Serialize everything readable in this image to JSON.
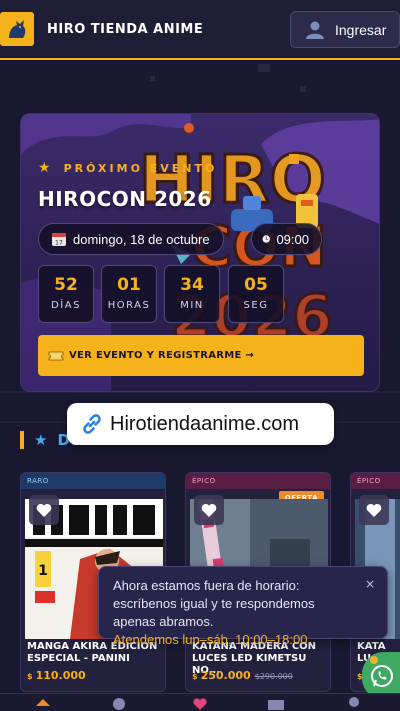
{
  "header": {
    "brand": "HIRO TIENDA ANIME",
    "login_label": "Ingresar"
  },
  "event": {
    "eyebrow": "PRÓXIMO EVENTO",
    "title": "HIROCON 2026",
    "date": "domingo, 18 de octubre",
    "time": "09:00",
    "countdown": [
      {
        "value": "52",
        "unit": "DÍAS"
      },
      {
        "value": "01",
        "unit": "HORAS"
      },
      {
        "value": "34",
        "unit": "MIN"
      },
      {
        "value": "05",
        "unit": "SEG"
      }
    ],
    "cta": "VER EVENTO Y REGISTRARME →"
  },
  "url_chip": "Hirotiendaanime.com",
  "section": {
    "title": "DESTACADOS"
  },
  "products": [
    {
      "rarity": "RARO",
      "name": "MANGA AKIRA EDICION ESPECIAL - PANINI",
      "currency": "$",
      "price": "110.000",
      "old_price": "",
      "badge": ""
    },
    {
      "rarity": "ÉPICO",
      "name": "KATANA MADERA CON LUCES LED KIMETSU NO...",
      "currency": "$",
      "price": "250.000",
      "old_price": "$290.000",
      "badge": "OFERTA"
    },
    {
      "rarity": "ÉPICO",
      "name": "KATA LUCE",
      "currency": "$",
      "price": "",
      "old_price": "",
      "badge": ""
    }
  ],
  "notice": {
    "message": "Ahora estamos fuera de horario: escríbenos igual y te respondemos apenas abramos.",
    "hours": "Atendemos lun–sáb, 10:00–18:00.",
    "close": "×"
  },
  "colors": {
    "accent": "#f5b21b",
    "background": "#1a1830",
    "blue": "#4aa8f0",
    "rare": "#4aa8f0",
    "epic": "#e0457b"
  }
}
